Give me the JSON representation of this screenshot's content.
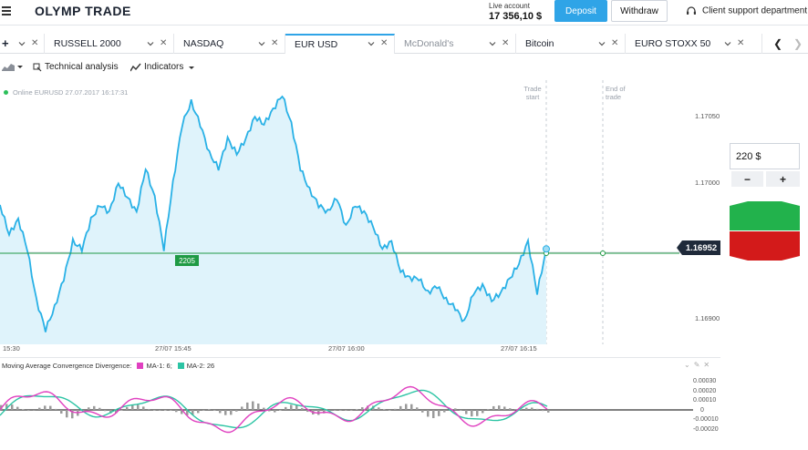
{
  "header": {
    "brand": "OLYMP TRADE",
    "account_label": "Live account",
    "balance": "17 356,10 $",
    "deposit_label": "Deposit",
    "withdraw_label": "Withdraw",
    "support_label": "Client support department"
  },
  "tabs": [
    {
      "label": "RUSSELL 2000",
      "active": false
    },
    {
      "label": "NASDAQ",
      "active": false
    },
    {
      "label": "EUR USD",
      "active": true
    },
    {
      "label": "McDonald's",
      "active": false
    },
    {
      "label": "Bitcoin",
      "active": false
    },
    {
      "label": "EURO STOXX 50",
      "active": false
    }
  ],
  "toolbar": {
    "technical_analysis": "Technical analysis",
    "indicators": "Indicators"
  },
  "chart": {
    "online_text": "Online EURUSD 27.07.2017 16:17:31",
    "trade_start": [
      "Trade",
      "start"
    ],
    "end_of_trade": [
      "End of",
      "trade"
    ],
    "current_price": "1.16952",
    "strike_amount": "2205",
    "colors": {
      "line": "#29b1e6",
      "fill": "#dff3fb",
      "strike": "#1f9a44",
      "up": "#22b24c",
      "down": "#d31a1a"
    }
  },
  "trade_panel": {
    "amount": "220 $",
    "minus": "−",
    "plus": "+"
  },
  "macd": {
    "title": "Moving Average Convergence Divergence:",
    "ma1": "MA-1: 6;",
    "ma2": "MA-2: 26",
    "ma1_color": "#e040c0",
    "ma2_color": "#2cc4a4",
    "y_ticks": [
      "0.00030",
      "0.00020",
      "0.00010",
      "0",
      "-0.00010",
      "-0.00020"
    ]
  },
  "chart_data": {
    "type": "line",
    "x_ticks": [
      "15:30",
      "27/07 15:45",
      "27/07 16:00",
      "27/07 16:15"
    ],
    "y_ticks": [
      "1.17050",
      "1.17000",
      "1.16900"
    ],
    "series": [
      {
        "values": [
          1.16985,
          1.16965,
          1.16975,
          1.16955,
          1.1692,
          1.169,
          1.16915,
          1.16935,
          1.1696,
          1.16955,
          1.16975,
          1.16985,
          1.1698,
          1.17,
          1.1699,
          1.1698,
          1.1701,
          1.1699,
          1.16955,
          1.17,
          1.1704,
          1.17055,
          1.1704,
          1.1702,
          1.1701,
          1.1703,
          1.1702,
          1.1703,
          1.17045,
          1.1704,
          1.1705,
          1.1706,
          1.1704,
          1.1701,
          1.16995,
          1.16985,
          1.1698,
          1.1699,
          1.1697,
          1.16985,
          1.1698,
          1.1697,
          1.16955,
          1.1696,
          1.1694,
          1.16935,
          1.16935,
          1.16925,
          1.1693,
          1.1692,
          1.16915,
          1.16905,
          1.16925,
          1.1693,
          1.1692,
          1.16925,
          1.16935,
          1.16945,
          1.1696,
          1.16925,
          1.16955
        ]
      }
    ],
    "ylim": [
      1.1689,
      1.1707
    ]
  }
}
